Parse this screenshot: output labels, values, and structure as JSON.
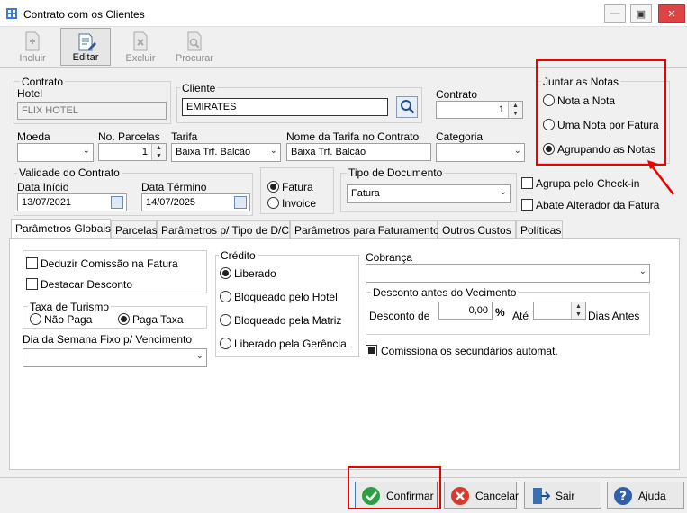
{
  "window": {
    "title": "Contrato com os Clientes"
  },
  "toolbar": {
    "incluir": "Incluir",
    "editar": "Editar",
    "excluir": "Excluir",
    "procurar": "Procurar"
  },
  "contrato_group": {
    "title": "Contrato",
    "hotel_label": "Hotel",
    "hotel_value": "FLIX HOTEL"
  },
  "cliente": {
    "label": "Cliente",
    "value": "EMIRATES"
  },
  "contrato_num": {
    "label": "Contrato",
    "value": "1"
  },
  "juntar_notas": {
    "title": "Juntar as Notas",
    "options": [
      "Nota a Nota",
      "Uma Nota por Fatura",
      "Agrupando as Notas"
    ],
    "selected": "Agrupando as Notas"
  },
  "moeda": {
    "label": "Moeda",
    "value": ""
  },
  "parcelas": {
    "label": "No. Parcelas",
    "value": "1"
  },
  "tarifa": {
    "label": "Tarifa",
    "value": "Baixa Trf. Balcão"
  },
  "nome_tarifa": {
    "label": "Nome da Tarifa no Contrato",
    "value": "Baixa Trf. Balcão"
  },
  "categoria": {
    "label": "Categoria",
    "value": ""
  },
  "validade": {
    "title": "Validade do Contrato",
    "inicio_label": "Data Início",
    "inicio_value": "13/07/2021",
    "termino_label": "Data Término",
    "termino_value": "14/07/2025"
  },
  "fatura_invoice": {
    "options": [
      "Fatura",
      "Invoice"
    ],
    "selected": "Fatura"
  },
  "tipo_documento": {
    "title": "Tipo de Documento",
    "value": "Fatura"
  },
  "checks": {
    "agrupa": "Agrupa pelo Check-in",
    "abate": "Abate Alterador da Fatura"
  },
  "tabs": [
    "Parâmetros Globais",
    "Parcelas",
    "Parâmetros p/ Tipo de D/C",
    "Parâmetros para Faturamento",
    "Outros Custos",
    "Políticas"
  ],
  "globais": {
    "deduzir": "Deduzir Comissão na Fatura",
    "destacar": "Destacar Desconto",
    "taxa_title": "Taxa de Turismo",
    "taxa_options": [
      "Não Paga",
      "Paga Taxa"
    ],
    "taxa_selected": "Paga Taxa",
    "dia_semana_label": "Dia da Semana Fixo p/ Vencimento",
    "dia_semana_value": "",
    "credito_title": "Crédito",
    "credito_options": [
      "Liberado",
      "Bloqueado pelo Hotel",
      "Bloqueado pela Matriz",
      "Liberado pela Gerência"
    ],
    "credito_selected": "Liberado",
    "cobranca_label": "Cobrança",
    "cobranca_value": "",
    "desconto_title": "Desconto antes do Vecimento",
    "desconto_de": "Desconto de",
    "desconto_value": "0,00",
    "pct": "%",
    "ate": "Até",
    "dias_value": "",
    "dias_antes": "Dias Antes",
    "comissiona": "Comissiona os secundários automat."
  },
  "buttons": {
    "confirmar": "Confirmar",
    "cancelar": "Cancelar",
    "sair": "Sair",
    "ajuda": "Ajuda"
  }
}
